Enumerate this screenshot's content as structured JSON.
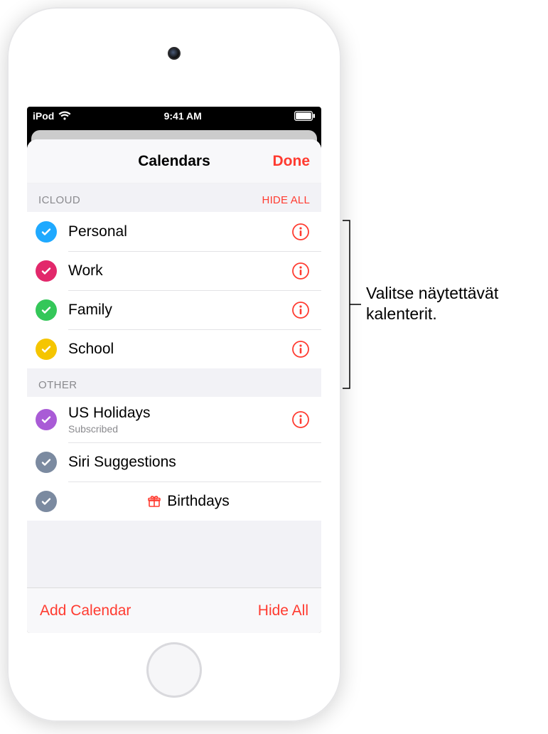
{
  "status": {
    "carrier": "iPod",
    "time": "9:41 AM"
  },
  "nav": {
    "title": "Calendars",
    "done": "Done"
  },
  "sections": {
    "icloud": {
      "header": "ICLOUD",
      "action": "HIDE ALL"
    },
    "other": {
      "header": "OTHER"
    }
  },
  "calendars": {
    "icloud": [
      {
        "label": "Personal",
        "color": "#1fa9ff"
      },
      {
        "label": "Work",
        "color": "#e2286b"
      },
      {
        "label": "Family",
        "color": "#34c759"
      },
      {
        "label": "School",
        "color": "#f5c500"
      }
    ],
    "other": [
      {
        "label": "US Holidays",
        "sub": "Subscribed",
        "color": "#a95bd6",
        "info": true
      },
      {
        "label": "Siri Suggestions",
        "color": "#7b8aa0",
        "info": false
      },
      {
        "label": "Birthdays",
        "color": "#7b8aa0",
        "info": false,
        "gift": true
      }
    ]
  },
  "toolbar": {
    "add": "Add Calendar",
    "hideAll": "Hide All"
  },
  "callout": {
    "line1": "Valitse näytettävät",
    "line2": "kalenterit."
  },
  "icons": {
    "check": "checkmark-icon",
    "info": "info-icon",
    "gift": "gift-icon",
    "wifi": "wifi-icon",
    "battery": "battery-icon"
  }
}
